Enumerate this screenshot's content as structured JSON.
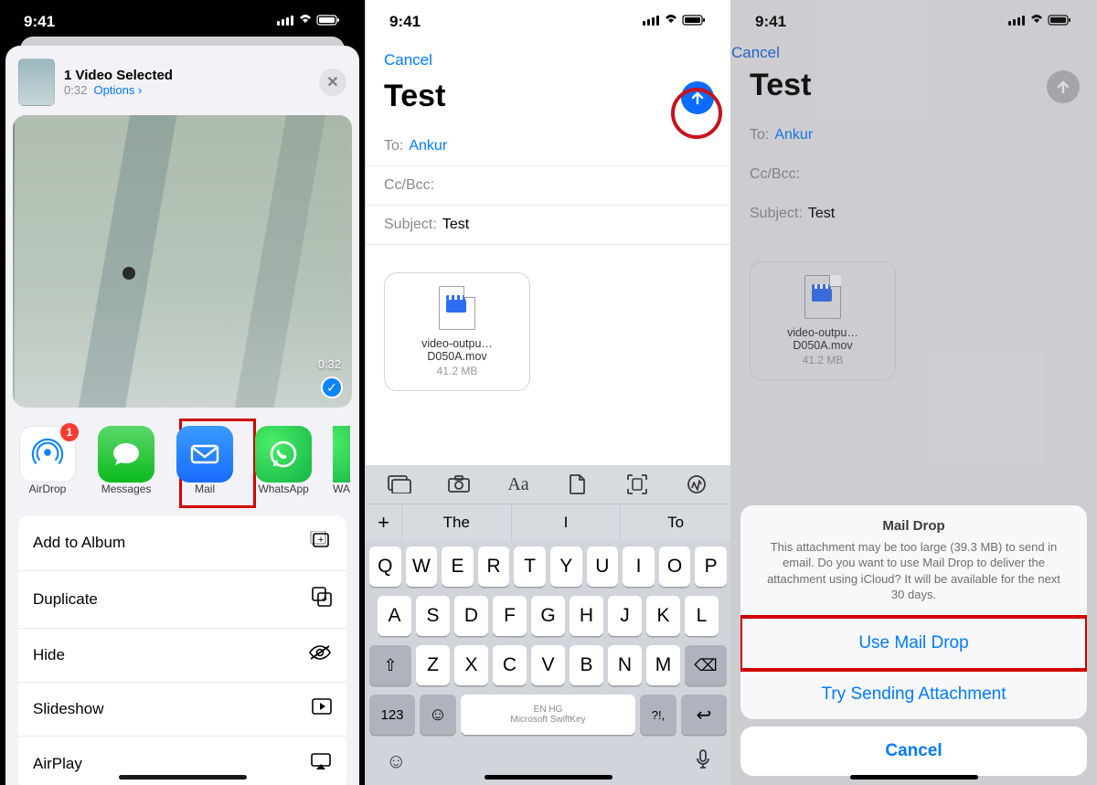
{
  "status": {
    "time": "9:41",
    "indicators": "􀙇 ııl ≣"
  },
  "screen1": {
    "header": {
      "title": "1 Video Selected",
      "duration": "0:32",
      "options": "Options ›"
    },
    "preview": {
      "duration": "0:32"
    },
    "apps": {
      "airdrop": {
        "label": "AirDrop",
        "badge": "1"
      },
      "messages": {
        "label": "Messages"
      },
      "mail": {
        "label": "Mail"
      },
      "whatsapp": {
        "label": "WhatsApp"
      },
      "wa": {
        "label": "WA"
      }
    },
    "actions": {
      "addToAlbum": "Add to Album",
      "duplicate": "Duplicate",
      "hide": "Hide",
      "slideshow": "Slideshow",
      "airplay": "AirPlay"
    }
  },
  "screen2": {
    "cancel": "Cancel",
    "subjectTitle": "Test",
    "fields": {
      "toLabel": "To:",
      "toValue": "Ankur",
      "ccbcc": "Cc/Bcc:",
      "subjectLabel": "Subject:",
      "subjectValue": "Test"
    },
    "attachment": {
      "name": "video-outpu…D050A.mov",
      "size": "41.2 MB"
    },
    "toolbar_glyphs": [
      "🖼",
      "📷",
      "Aa",
      "📄",
      "⎙",
      "@"
    ],
    "suggest": {
      "plus": "+",
      "s1": "The",
      "s2": "I",
      "s3": "To"
    },
    "keys": {
      "r1": [
        "Q",
        "W",
        "E",
        "R",
        "T",
        "Y",
        "U",
        "I",
        "O",
        "P"
      ],
      "r2": [
        "A",
        "S",
        "D",
        "F",
        "G",
        "H",
        "J",
        "K",
        "L"
      ],
      "r3": [
        "Z",
        "X",
        "C",
        "V",
        "B",
        "N",
        "M"
      ],
      "num": "123",
      "space1": "EN HG",
      "space2": "Microsoft SwiftKey",
      "punct": "?!,"
    }
  },
  "screen3": {
    "cancel": "Cancel",
    "subjectTitle": "Test",
    "fields": {
      "toLabel": "To:",
      "toValue": "Ankur",
      "ccbcc": "Cc/Bcc:",
      "subjectLabel": "Subject:",
      "subjectValue": "Test"
    },
    "attachment": {
      "name": "video-outpu…D050A.mov",
      "size": "41.2 MB"
    },
    "sheet": {
      "title": "Mail Drop",
      "desc": "This attachment may be too large (39.3 MB) to send in email. Do you want to use Mail Drop to deliver the attachment using iCloud? It will be available for the next 30 days.",
      "useMailDrop": "Use Mail Drop",
      "trySend": "Try Sending Attachment",
      "cancelBtn": "Cancel"
    }
  }
}
